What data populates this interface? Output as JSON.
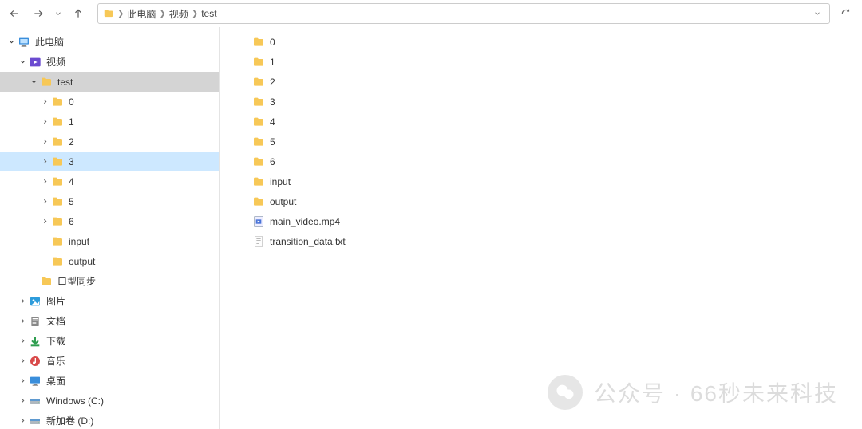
{
  "nav": {
    "back": "←",
    "forward": "→",
    "up": "↑"
  },
  "breadcrumbs": [
    "此电脑",
    "视频",
    "test"
  ],
  "sidebar": [
    {
      "indent": 0,
      "exp": "open",
      "icon": "pc",
      "label": "此电脑",
      "sel": ""
    },
    {
      "indent": 1,
      "exp": "open",
      "icon": "video",
      "label": "视频",
      "sel": ""
    },
    {
      "indent": 2,
      "exp": "open",
      "icon": "folder",
      "label": "test",
      "sel": "selected"
    },
    {
      "indent": 3,
      "exp": "closed",
      "icon": "folder",
      "label": "0",
      "sel": ""
    },
    {
      "indent": 3,
      "exp": "closed",
      "icon": "folder",
      "label": "1",
      "sel": ""
    },
    {
      "indent": 3,
      "exp": "closed",
      "icon": "folder",
      "label": "2",
      "sel": ""
    },
    {
      "indent": 3,
      "exp": "closed",
      "icon": "folder",
      "label": "3",
      "sel": "hover-sel"
    },
    {
      "indent": 3,
      "exp": "closed",
      "icon": "folder",
      "label": "4",
      "sel": ""
    },
    {
      "indent": 3,
      "exp": "closed",
      "icon": "folder",
      "label": "5",
      "sel": ""
    },
    {
      "indent": 3,
      "exp": "closed",
      "icon": "folder",
      "label": "6",
      "sel": ""
    },
    {
      "indent": 3,
      "exp": "none",
      "icon": "folder",
      "label": "input",
      "sel": ""
    },
    {
      "indent": 3,
      "exp": "none",
      "icon": "folder",
      "label": "output",
      "sel": ""
    },
    {
      "indent": 2,
      "exp": "none",
      "icon": "folder",
      "label": "口型同步",
      "sel": ""
    },
    {
      "indent": 1,
      "exp": "closed",
      "icon": "pictures",
      "label": "图片",
      "sel": ""
    },
    {
      "indent": 1,
      "exp": "closed",
      "icon": "docs",
      "label": "文档",
      "sel": ""
    },
    {
      "indent": 1,
      "exp": "closed",
      "icon": "download",
      "label": "下载",
      "sel": ""
    },
    {
      "indent": 1,
      "exp": "closed",
      "icon": "music",
      "label": "音乐",
      "sel": ""
    },
    {
      "indent": 1,
      "exp": "closed",
      "icon": "desktop",
      "label": "桌面",
      "sel": ""
    },
    {
      "indent": 1,
      "exp": "closed",
      "icon": "drive",
      "label": "Windows (C:)",
      "sel": ""
    },
    {
      "indent": 1,
      "exp": "closed",
      "icon": "drive",
      "label": "新加卷 (D:)",
      "sel": ""
    }
  ],
  "files": [
    {
      "icon": "folder",
      "name": "0"
    },
    {
      "icon": "folder",
      "name": "1"
    },
    {
      "icon": "folder",
      "name": "2"
    },
    {
      "icon": "folder",
      "name": "3"
    },
    {
      "icon": "folder",
      "name": "4"
    },
    {
      "icon": "folder",
      "name": "5"
    },
    {
      "icon": "folder",
      "name": "6"
    },
    {
      "icon": "folder",
      "name": "input"
    },
    {
      "icon": "folder",
      "name": "output"
    },
    {
      "icon": "videofile",
      "name": "main_video.mp4"
    },
    {
      "icon": "textfile",
      "name": "transition_data.txt"
    }
  ],
  "watermark": "公众号 · 66秒未来科技"
}
